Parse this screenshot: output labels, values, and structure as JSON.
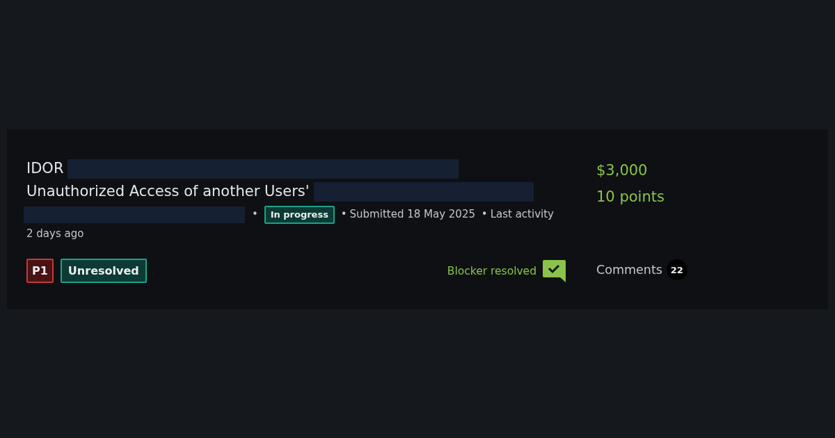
{
  "report": {
    "title_lines": [
      "IDOR",
      "Unauthorized Access of another Users'"
    ],
    "state_badge": "In progress",
    "submitted": "Submitted 18 May 2025",
    "separator": "•",
    "last_activity": [
      "Last activity",
      "2 days ago"
    ],
    "severity": "P1",
    "resolution": "Unresolved",
    "blocker": {
      "label": "Blocker resolved",
      "resolved": true
    },
    "bounty": "$3,000",
    "points": "10 points",
    "comments": {
      "label": "Comments",
      "count": "22"
    }
  }
}
